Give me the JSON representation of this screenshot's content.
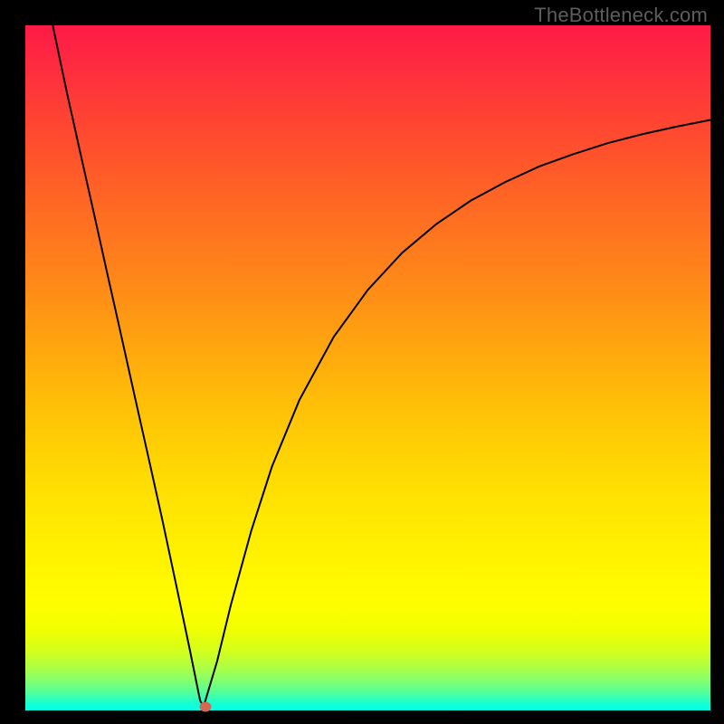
{
  "watermark": "TheBottleneck.com",
  "chart_data": {
    "type": "line",
    "title": "",
    "xlabel": "",
    "ylabel": "",
    "xlim": [
      0,
      100
    ],
    "ylim": [
      0,
      100
    ],
    "grid": false,
    "legend": false,
    "annotation_dot": {
      "x_pct": 26.3,
      "y_pct": 0.5
    },
    "series": [
      {
        "name": "left-branch",
        "x": [
          4.0,
          6.0,
          8.0,
          10.0,
          12.0,
          14.0,
          16.0,
          18.0,
          20.0,
          22.0,
          24.0,
          25.5,
          26.0
        ],
        "y": [
          100.0,
          90.5,
          81.5,
          72.6,
          63.6,
          54.7,
          45.7,
          36.8,
          27.8,
          18.4,
          8.9,
          1.5,
          0.5
        ]
      },
      {
        "name": "right-branch",
        "x": [
          26.0,
          28.0,
          30.0,
          33.0,
          36.0,
          40.0,
          45.0,
          50.0,
          55.0,
          60.0,
          65.0,
          70.0,
          75.0,
          80.0,
          85.0,
          90.0,
          95.0,
          100.0
        ],
        "y": [
          0.5,
          7.2,
          15.4,
          26.3,
          35.6,
          45.3,
          54.5,
          61.4,
          66.8,
          71.0,
          74.4,
          77.1,
          79.4,
          81.2,
          82.8,
          84.1,
          85.2,
          86.2
        ]
      }
    ],
    "background_gradient": {
      "stops": [
        {
          "pos": 0.0,
          "color": "#fe1a46"
        },
        {
          "pos": 0.22,
          "color": "#ff5c28"
        },
        {
          "pos": 0.46,
          "color": "#ffa310"
        },
        {
          "pos": 0.7,
          "color": "#ffe402"
        },
        {
          "pos": 0.88,
          "color": "#f2ff00"
        },
        {
          "pos": 0.96,
          "color": "#87ff6a"
        },
        {
          "pos": 1.0,
          "color": "#05ffe8"
        }
      ]
    }
  }
}
